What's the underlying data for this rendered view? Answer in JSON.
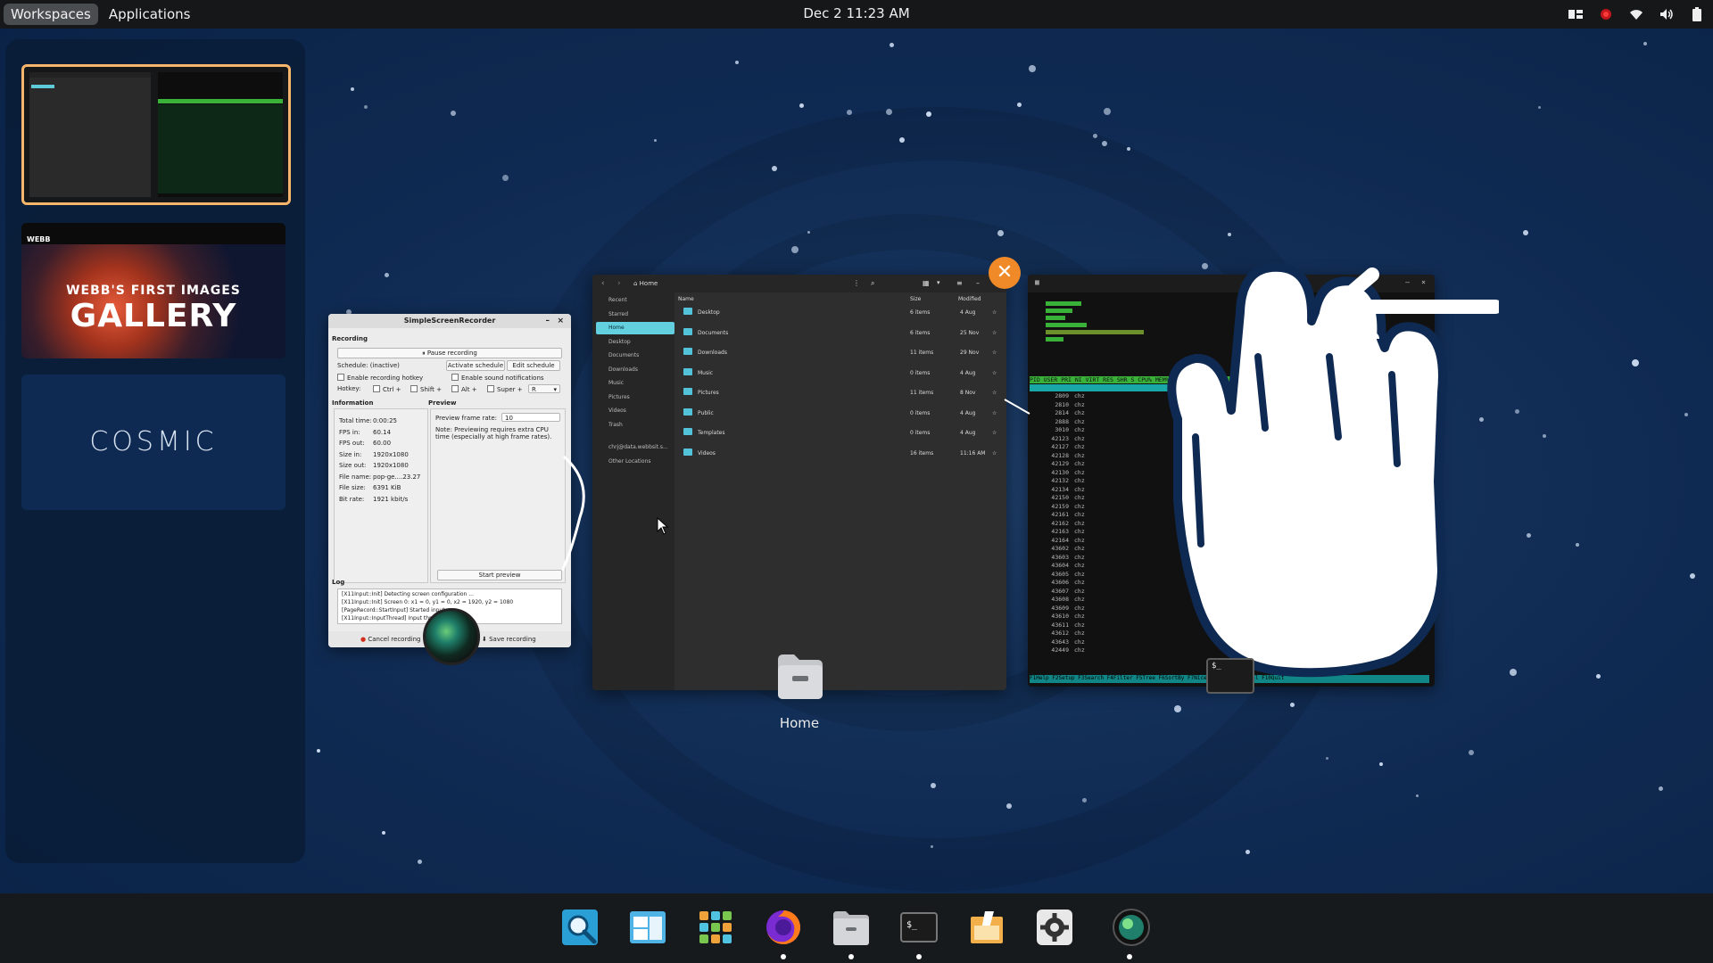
{
  "topbar": {
    "workspaces_label": "Workspaces",
    "applications_label": "Applications",
    "clock": "Dec 2  11:23 AM"
  },
  "workspaces": {
    "ws2_title_small": "WEBB'S FIRST IMAGES",
    "ws2_title_big": "GALLERY",
    "ws2_logo": "WEBB",
    "ws3_text": "COSMIC"
  },
  "ssr": {
    "title": "SimpleScreenRecorder",
    "recording_section": "Recording",
    "pause_button": "Pause recording",
    "schedule_label": "Schedule: (inactive)",
    "activate_schedule": "Activate schedule",
    "edit_schedule": "Edit schedule",
    "enable_hotkey": "Enable recording hotkey",
    "enable_sound": "Enable sound notifications",
    "hotkey_label": "Hotkey:",
    "ctrl": "Ctrl +",
    "shift": "Shift +",
    "alt": "Alt +",
    "super": "Super +",
    "key": "R",
    "information": "Information",
    "preview": "Preview",
    "info_rows": [
      {
        "k": "Total time:",
        "v": "0:00:25"
      },
      {
        "k": "FPS in:",
        "v": "60.14"
      },
      {
        "k": "FPS out:",
        "v": "60.00"
      },
      {
        "k": "Size in:",
        "v": "1920x1080"
      },
      {
        "k": "Size out:",
        "v": "1920x1080"
      },
      {
        "k": "File name:",
        "v": "pop-ge....23.27"
      },
      {
        "k": "File size:",
        "v": "6391 KiB"
      },
      {
        "k": "Bit rate:",
        "v": "1921 kbit/s"
      }
    ],
    "preview_rate_label": "Preview frame rate:",
    "preview_rate_value": "10",
    "preview_note": "Note: Previewing requires extra CPU time (especially at high frame rates).",
    "start_preview": "Start preview",
    "log_label": "Log",
    "log_lines": [
      "[X11Input::Init] Detecting screen configuration ...",
      "[X11Input::Init] Screen 0: x1 = 0, y1 = 0, x2 = 1920, y2 = 1080",
      "[PageRecord::StartInput] Started input.",
      "[X11Input::InputThread] Input thread started."
    ],
    "cancel_recording": "Cancel recording",
    "save_recording": "Save recording"
  },
  "files": {
    "path": "Home",
    "sidebar": [
      "Recent",
      "Starred",
      "Home",
      "Desktop",
      "Documents",
      "Downloads",
      "Music",
      "Pictures",
      "Videos",
      "Trash",
      "chrj@data.webbsit.s...",
      "Other Locations"
    ],
    "sidebar_selected": "Home",
    "columns": {
      "name": "Name",
      "size": "Size",
      "modified": "Modified"
    },
    "rows": [
      {
        "name": "Desktop",
        "size": "6 items",
        "modified": "4 Aug"
      },
      {
        "name": "Documents",
        "size": "6 items",
        "modified": "25 Nov"
      },
      {
        "name": "Downloads",
        "size": "11 items",
        "modified": "29 Nov"
      },
      {
        "name": "Music",
        "size": "0 items",
        "modified": "4 Aug"
      },
      {
        "name": "Pictures",
        "size": "11 items",
        "modified": "8 Nov"
      },
      {
        "name": "Public",
        "size": "0 items",
        "modified": "4 Aug"
      },
      {
        "name": "Templates",
        "size": "0 items",
        "modified": "4 Aug"
      },
      {
        "name": "Videos",
        "size": "16 items",
        "modified": "11:16 AM"
      }
    ]
  },
  "terminal": {
    "header": "  PID USER      PRI  NI  VIRT   RES   SHR S CPU% MEM%   TIME+  Command",
    "pids": [
      "2809",
      "2810",
      "2814",
      "2888",
      "3010",
      "42123",
      "42127",
      "42128",
      "42129",
      "42130",
      "42132",
      "42134",
      "42150",
      "42159",
      "42161",
      "42162",
      "42163",
      "42164",
      "43602",
      "43603",
      "43604",
      "43605",
      "43606",
      "43607",
      "43608",
      "43609",
      "43610",
      "43611",
      "43612",
      "43643",
      "42449"
    ],
    "user": "chz",
    "fbar": "F1Help F2Setup F3Search F4Filter F5Tree F6SortBy F7Nice- F8Nice+ F9Kill F10Quit",
    "mini_prompt": "$_"
  },
  "desktop": {
    "home_label": "Home"
  },
  "dock": {
    "items": [
      "search-app",
      "files-manager",
      "app-grid",
      "firefox",
      "files",
      "terminal",
      "text-editor",
      "settings",
      "screen-recorder"
    ]
  },
  "colors": {
    "accent": "#f5b56b",
    "close": "#f08a28",
    "folder": "#52c3d8",
    "htop_green": "#3ab23a",
    "htop_cyan": "#19a7a7"
  }
}
